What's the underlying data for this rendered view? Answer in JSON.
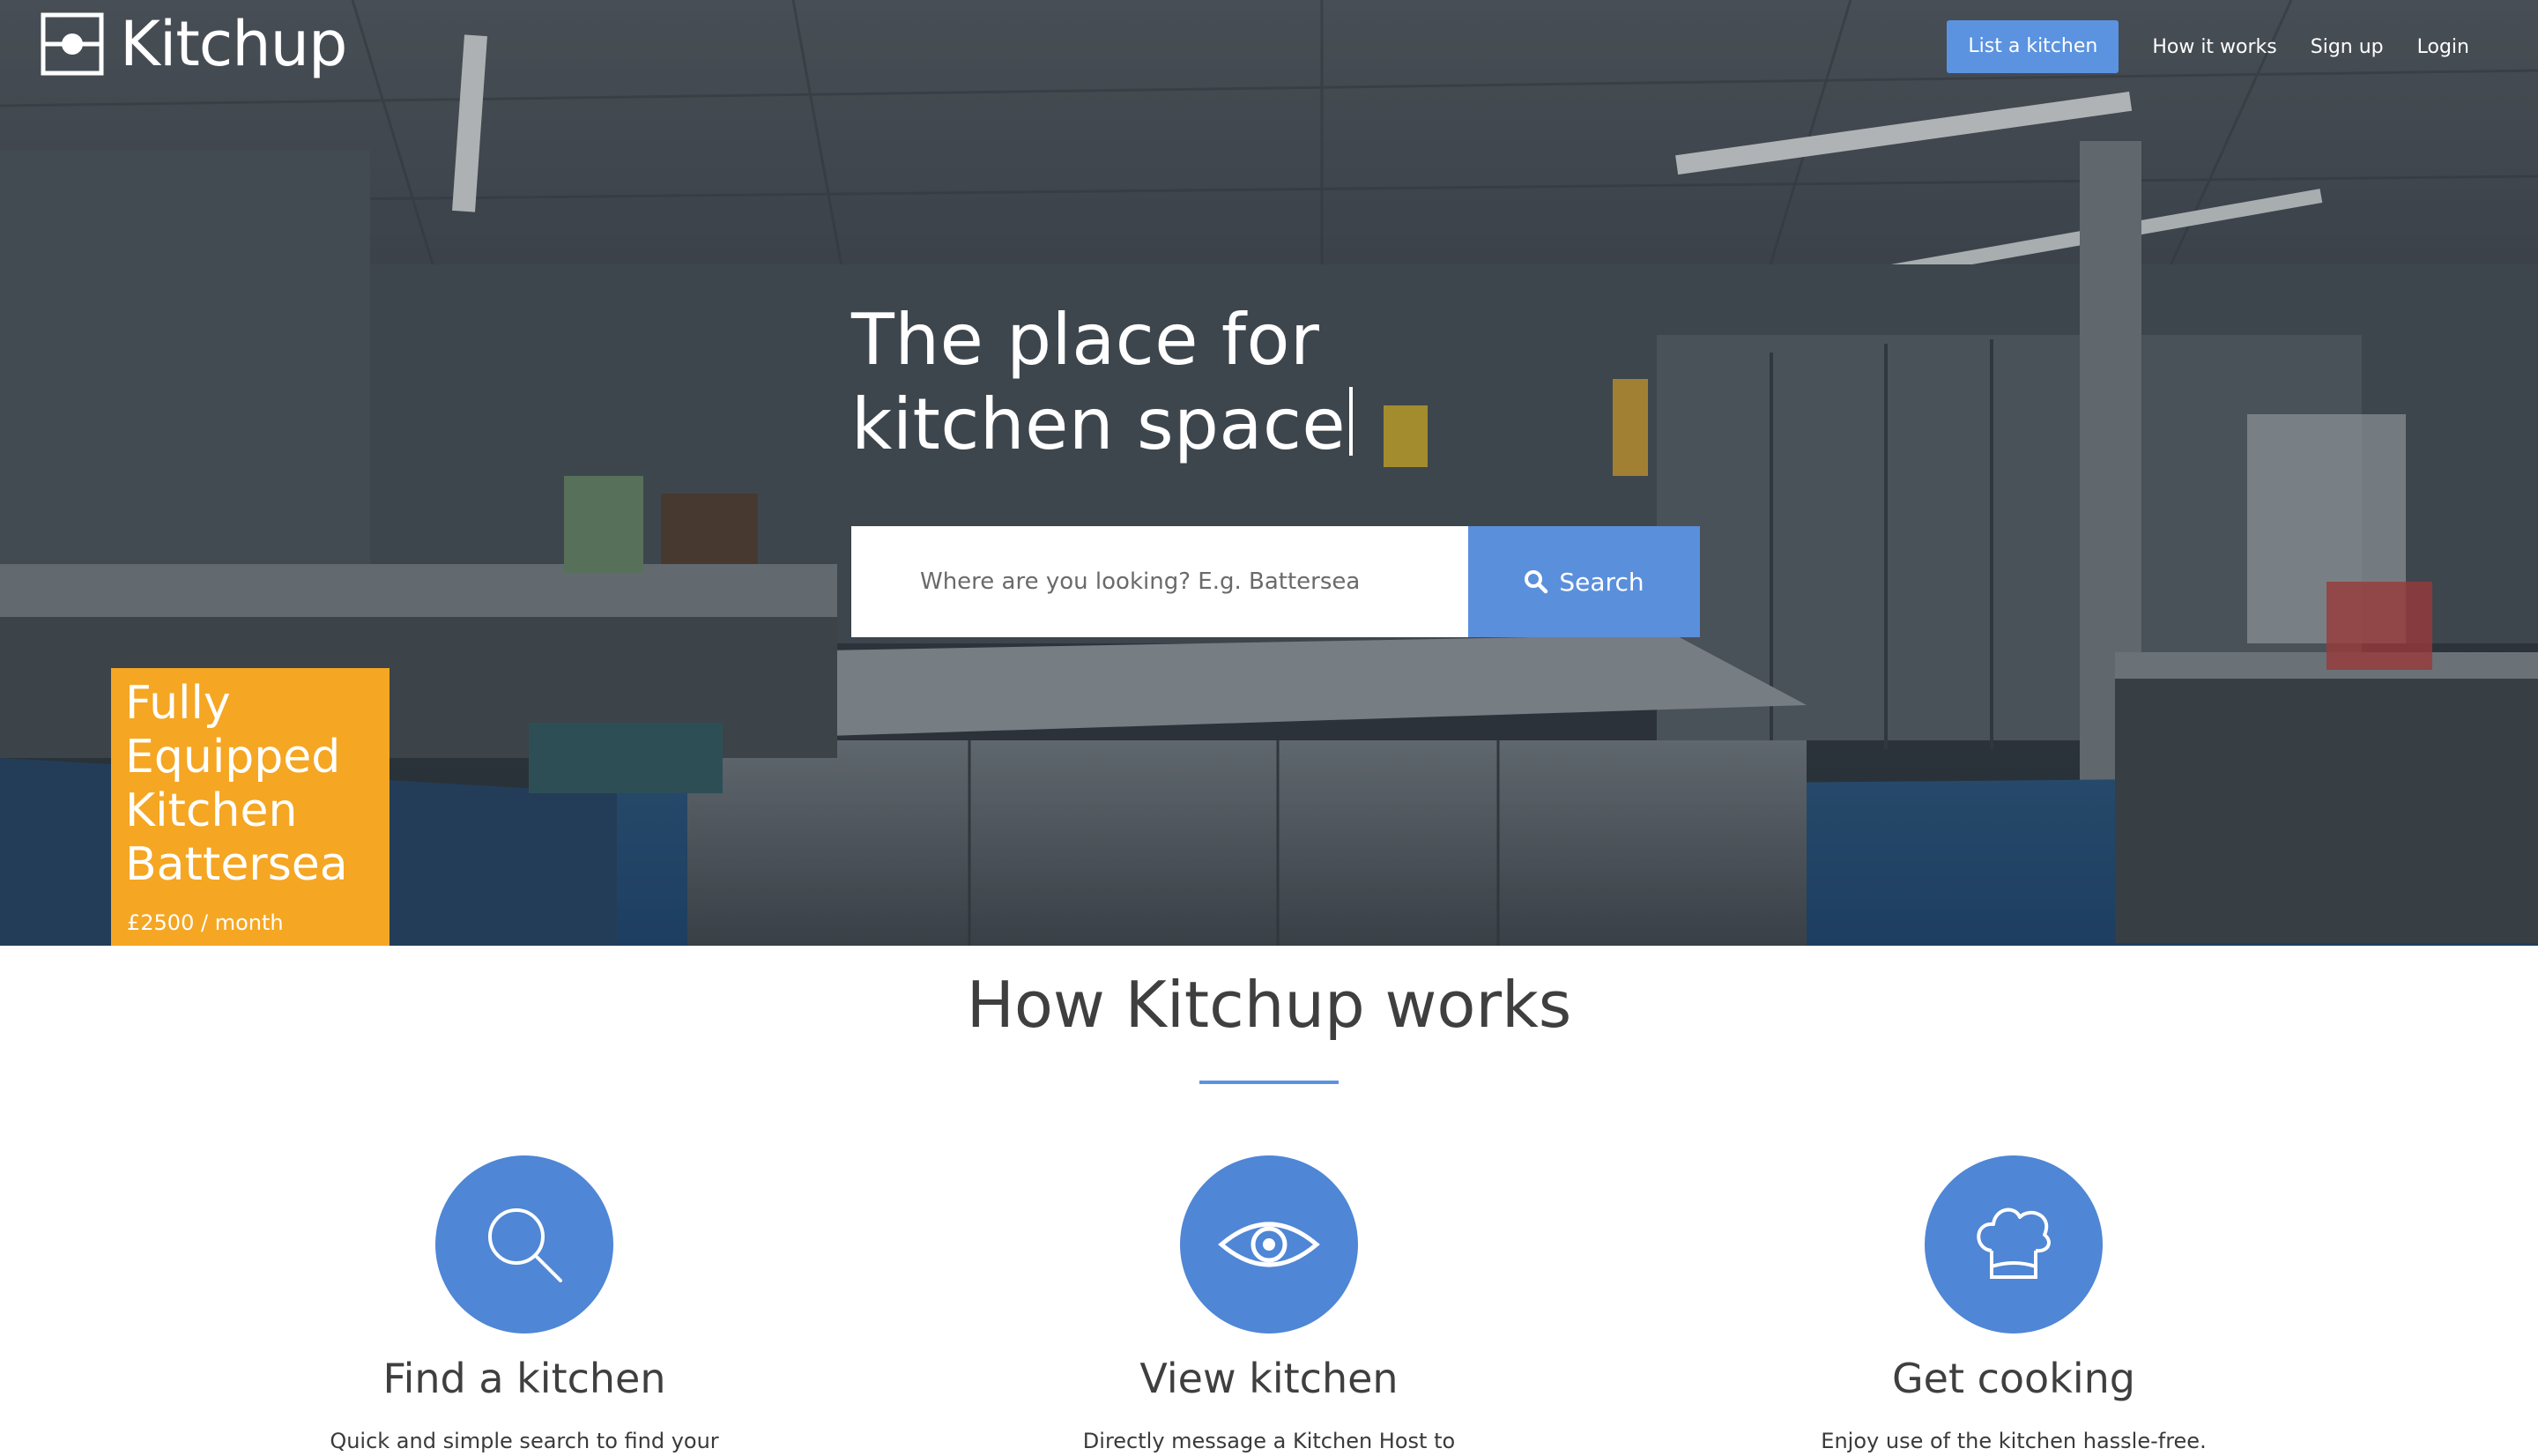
{
  "brand": {
    "name": "Kitchup"
  },
  "nav": {
    "cta_label": "List a kitchen",
    "links": [
      "How it works",
      "Sign up",
      "Login"
    ]
  },
  "hero": {
    "headline_line1": "The place for",
    "headline_line2": "kitchen space",
    "search_placeholder": "Where are you looking? E.g. Battersea",
    "search_button": "Search"
  },
  "listing": {
    "title_lines": [
      "Fully",
      "Equipped",
      "Kitchen",
      "Battersea"
    ],
    "price": "£2500 / month"
  },
  "how": {
    "title": "How Kitchup works",
    "steps": [
      {
        "icon": "magnifier-icon",
        "title": "Find a kitchen",
        "desc": "Quick and simple search to find your"
      },
      {
        "icon": "eye-icon",
        "title": "View kitchen",
        "desc": "Directly message a Kitchen Host to"
      },
      {
        "icon": "chef-hat-icon",
        "title": "Get cooking",
        "desc": "Enjoy use of the kitchen hassle-free."
      }
    ]
  },
  "colors": {
    "accent": "#5b93e0",
    "card": "#f5a623",
    "icon_circle": "#4f86d6"
  }
}
